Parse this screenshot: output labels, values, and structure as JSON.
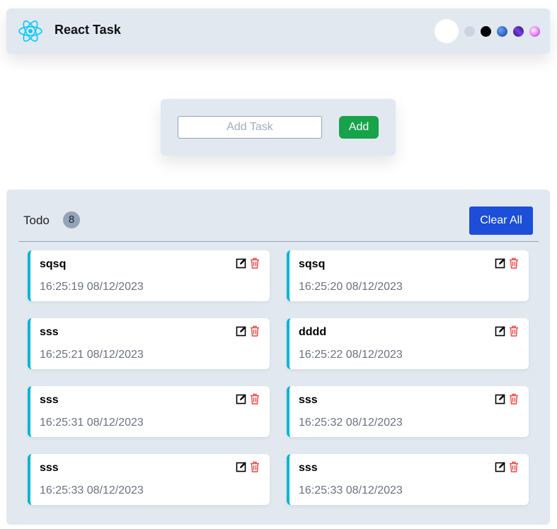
{
  "header": {
    "title": "React Task",
    "logo_icon": "react-atom-icon",
    "themes": [
      {
        "name": "white",
        "color": "#ffffff",
        "active": true
      },
      {
        "name": "light-gray",
        "color": "#cbd5e1"
      },
      {
        "name": "black",
        "color": "#000000"
      },
      {
        "name": "blue",
        "color": "#2563eb"
      },
      {
        "name": "purple",
        "color": "#5b21b6"
      },
      {
        "name": "pink",
        "color": "#e879f9"
      }
    ]
  },
  "add_task": {
    "placeholder": "Add Task",
    "value": "",
    "button_label": "Add"
  },
  "board": {
    "title": "Todo",
    "count": "8",
    "clear_label": "Clear All"
  },
  "tasks": [
    {
      "name": "sqsq",
      "time": "16:25:19 08/12/2023"
    },
    {
      "name": "sqsq",
      "time": "16:25:20 08/12/2023"
    },
    {
      "name": "sss",
      "time": "16:25:21 08/12/2023"
    },
    {
      "name": "dddd",
      "time": "16:25:22 08/12/2023"
    },
    {
      "name": "sss",
      "time": "16:25:31 08/12/2023"
    },
    {
      "name": "sss",
      "time": "16:25:32 08/12/2023"
    },
    {
      "name": "sss",
      "time": "16:25:33 08/12/2023"
    },
    {
      "name": "sss",
      "time": "16:25:33 08/12/2023"
    }
  ],
  "colors": {
    "accent": "#06b6d4",
    "add_button": "#16a34a",
    "clear_button": "#1d4ed8",
    "delete_icon": "#ef4444"
  }
}
